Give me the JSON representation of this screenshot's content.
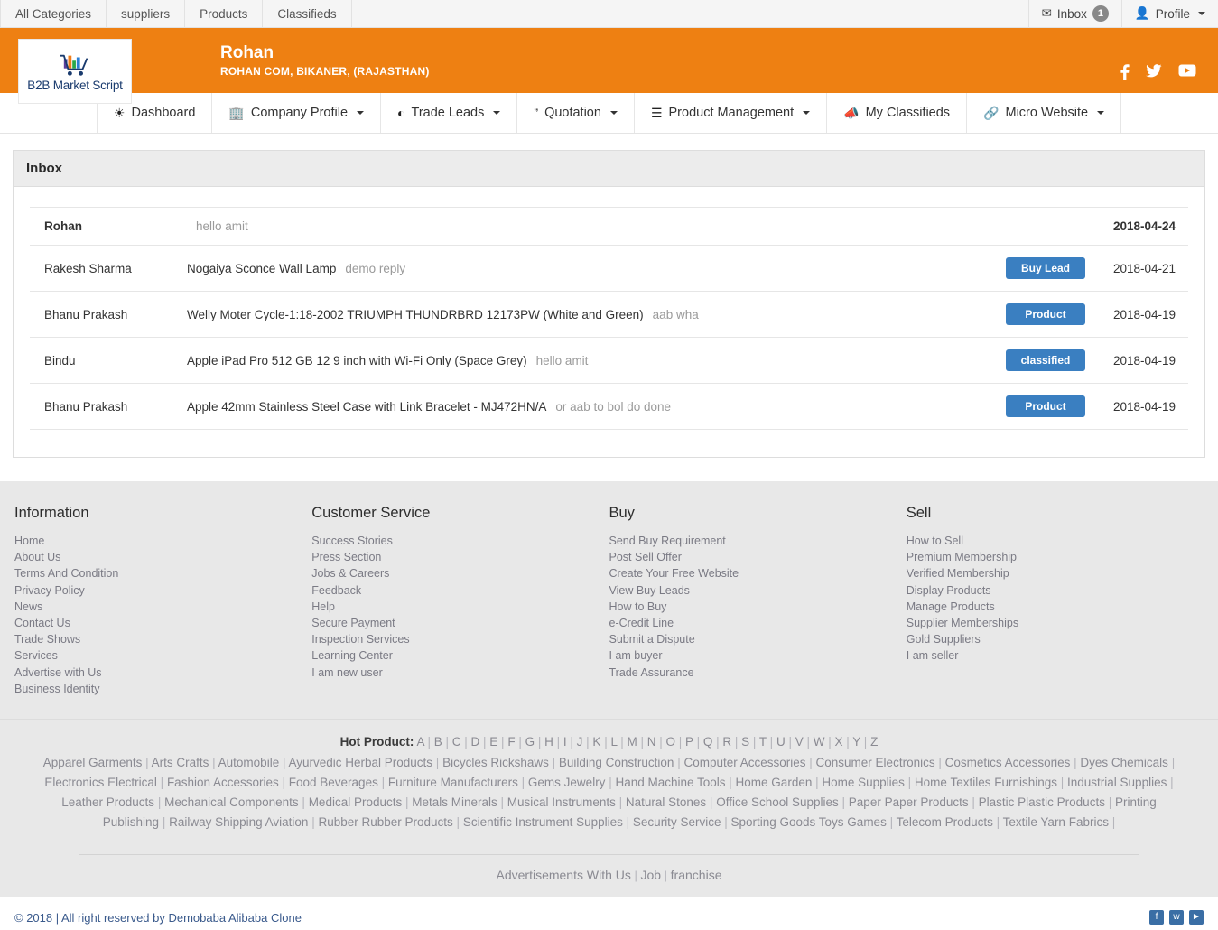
{
  "topbar": {
    "nav": [
      {
        "label": "All Categories"
      },
      {
        "label": "suppliers"
      },
      {
        "label": "Products"
      },
      {
        "label": "Classifieds"
      }
    ],
    "inbox_label": "Inbox",
    "inbox_count": "1",
    "profile_label": "Profile"
  },
  "brand": {
    "logo_text": "B2B Market Script",
    "title": "Rohan",
    "subtitle": "ROHAN COM, BIKANER, (RAJASTHAN)",
    "bg_color": "#ee8012",
    "social": [
      "facebook-icon",
      "twitter-icon",
      "youtube-icon"
    ]
  },
  "mainnav": [
    {
      "label": "Dashboard",
      "icon": "dashboard-icon",
      "caret": false
    },
    {
      "label": "Company Profile",
      "icon": "building-icon",
      "caret": true
    },
    {
      "label": "Trade Leads",
      "icon": "pie-chart-icon",
      "caret": true
    },
    {
      "label": "Quotation",
      "icon": "quote-icon",
      "caret": true
    },
    {
      "label": "Product Management",
      "icon": "list-icon",
      "caret": true
    },
    {
      "label": "My Classifieds",
      "icon": "bullhorn-icon",
      "caret": false
    },
    {
      "label": "Micro Website",
      "icon": "link-icon",
      "caret": true
    }
  ],
  "panel": {
    "title": "Inbox",
    "rows": [
      {
        "sender": "Rohan",
        "subject": "",
        "snippet": "hello amit",
        "tag": "",
        "date": "2018-04-24",
        "bold": true
      },
      {
        "sender": "Rakesh Sharma",
        "subject": "Nogaiya Sconce Wall Lamp",
        "snippet": "demo reply",
        "tag": "Buy Lead",
        "date": "2018-04-21",
        "bold": false
      },
      {
        "sender": "Bhanu Prakash",
        "subject": "Welly Moter Cycle-1:18-2002 TRIUMPH THUNDRBRD 12173PW (White and Green)",
        "snippet": "aab wha",
        "tag": "Product",
        "date": "2018-04-19",
        "bold": false
      },
      {
        "sender": "Bindu",
        "subject": "Apple iPad Pro 512 GB 12 9 inch with Wi-Fi Only (Space Grey)",
        "snippet": "hello amit",
        "tag": "classified",
        "date": "2018-04-19",
        "bold": false
      },
      {
        "sender": "Bhanu Prakash",
        "subject": "Apple 42mm Stainless Steel Case with Link Bracelet - MJ472HN/A",
        "snippet": "or aab to bol do done",
        "tag": "Product",
        "date": "2018-04-19",
        "bold": false
      }
    ],
    "tag_color": "#3a7fc1"
  },
  "footer": {
    "columns": [
      {
        "heading": "Information",
        "links": [
          "Home",
          "About Us",
          "Terms And Condition",
          "Privacy Policy",
          "News",
          "Contact Us",
          "Trade Shows",
          "Services",
          "Advertise with Us",
          "Business Identity"
        ]
      },
      {
        "heading": "Customer Service",
        "links": [
          "Success Stories",
          "Press Section",
          "Jobs & Careers",
          "Feedback",
          "Help",
          "Secure Payment",
          "Inspection Services",
          "Learning Center",
          "I am new user"
        ]
      },
      {
        "heading": "Buy",
        "links": [
          "Send Buy Requirement",
          "Post Sell Offer",
          "Create Your Free Website",
          "View Buy Leads",
          "How to Buy",
          "e-Credit Line",
          "Submit a Dispute",
          "I am buyer",
          "Trade Assurance"
        ]
      },
      {
        "heading": "Sell",
        "links": [
          "How to Sell",
          "Premium Membership",
          "Verified Membership",
          "Display Products",
          "Manage Products",
          "Supplier Memberships",
          "Gold Suppliers",
          "I am seller"
        ]
      }
    ],
    "hot_product_label": "Hot Product:",
    "alphabet": [
      "A",
      "B",
      "C",
      "D",
      "E",
      "F",
      "G",
      "H",
      "I",
      "J",
      "K",
      "L",
      "M",
      "N",
      "O",
      "P",
      "Q",
      "R",
      "S",
      "T",
      "U",
      "V",
      "W",
      "X",
      "Y",
      "Z"
    ],
    "categories": [
      "Apparel Garments",
      "Arts Crafts",
      "Automobile",
      "Ayurvedic Herbal Products",
      "Bicycles Rickshaws",
      "Building Construction",
      "Computer Accessories",
      "Consumer Electronics",
      "Cosmetics Accessories",
      "Dyes Chemicals",
      "Electronics Electrical",
      "Fashion Accessories",
      "Food Beverages",
      "Furniture Manufacturers",
      "Gems Jewelry",
      "Hand Machine Tools",
      "Home Garden",
      "Home Supplies",
      "Home Textiles Furnishings",
      "Industrial Supplies",
      "Leather Products",
      "Mechanical Components",
      "Medical Products",
      "Metals Minerals",
      "Musical Instruments",
      "Natural Stones",
      "Office School Supplies",
      "Paper Paper Products",
      "Plastic Plastic Products",
      "Printing Publishing",
      "Railway Shipping Aviation",
      "Rubber Rubber Products",
      "Scientific Instrument Supplies",
      "Security Service",
      "Sporting Goods Toys Games",
      "Telecom Products",
      "Textile Yarn Fabrics"
    ],
    "bottom_links": [
      "Advertisements With Us",
      "Job",
      "franchise"
    ],
    "copyright": "© 2018 | All right reserved by Demobaba Alibaba Clone",
    "bottom_social": [
      "facebook-icon",
      "twitter-icon",
      "youtube-icon"
    ]
  }
}
